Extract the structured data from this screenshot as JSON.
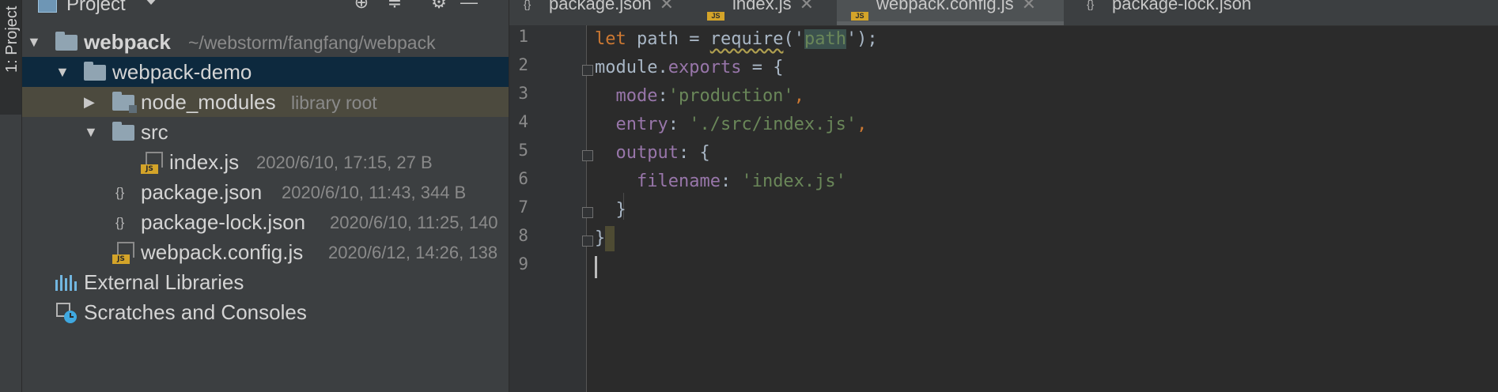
{
  "toolstrip": {
    "label": "1: Project"
  },
  "project": {
    "title": "Project",
    "tree": [
      {
        "name": "webpack",
        "meta": "~/webstorm/fangfang/webpack"
      },
      {
        "name": "webpack-demo"
      },
      {
        "name": "node_modules",
        "meta": "library root"
      },
      {
        "name": "src"
      },
      {
        "name": "index.js",
        "meta": "2020/6/10, 17:15, 27 B"
      },
      {
        "name": "package.json",
        "meta": "2020/6/10, 11:43, 344 B"
      },
      {
        "name": "package-lock.json",
        "meta": "2020/6/10, 11:25, 140"
      },
      {
        "name": "webpack.config.js",
        "meta": "2020/6/12, 14:26, 138"
      },
      {
        "name": "External Libraries"
      },
      {
        "name": "Scratches and Consoles"
      }
    ]
  },
  "tabs": [
    {
      "label": "package.json"
    },
    {
      "label": "index.js"
    },
    {
      "label": "webpack.config.js"
    },
    {
      "label": "package-lock.json"
    }
  ],
  "editor": {
    "line_numbers": [
      "1",
      "2",
      "3",
      "4",
      "5",
      "6",
      "7",
      "8",
      "9"
    ],
    "lines": {
      "l1": {
        "kw": "let",
        "var": "path",
        "eq": " = ",
        "fn": "require",
        "open": "('",
        "str": "path",
        "close": "');"
      },
      "l2": {
        "obj": "module",
        "dot": ".",
        "prop": "exports",
        "rest": " = {"
      },
      "l3": {
        "prop": "mode",
        "colon": ":",
        "str": "'production'",
        "comma": ","
      },
      "l4": {
        "prop": "entry",
        "colon": ": ",
        "str": "'./src/index.js'",
        "comma": ","
      },
      "l5": {
        "prop": "output",
        "rest": ": {"
      },
      "l6": {
        "prop": "filename",
        "colon": ": ",
        "str": "'index.js'"
      },
      "l7": {
        "text": "}"
      },
      "l8": {
        "text": "}"
      }
    }
  },
  "colors": {
    "background": "#2b2b2b",
    "panel": "#3c3f41",
    "selection": "#0d293e",
    "library_row": "#4c4a3e",
    "js_badge": "#d4a429"
  }
}
